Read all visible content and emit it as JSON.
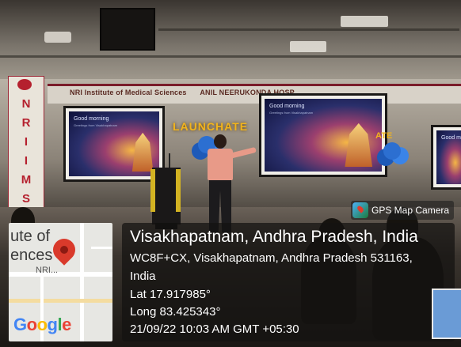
{
  "scene": {
    "banner_text": "NRI Institute of Medical Sciences",
    "banner_text_2": "ANIL NEERUKONDA HOSP",
    "vertical_banner_letters": [
      "N",
      "R",
      "I",
      "I",
      "M",
      "S"
    ],
    "sign_launch": "LAUNCHATE",
    "sign_right": "ATE",
    "slide_title": "Good morning",
    "slide_subtitle": "Greetings from Visakhapatnam"
  },
  "map": {
    "label_line1": "ute of",
    "label_line2": "ences",
    "label_line3": "NRI...",
    "logo_letters": [
      {
        "ch": "G",
        "color": "#4285F4"
      },
      {
        "ch": "o",
        "color": "#EA4335"
      },
      {
        "ch": "o",
        "color": "#FBBC05"
      },
      {
        "ch": "g",
        "color": "#4285F4"
      },
      {
        "ch": "l",
        "color": "#34A853"
      },
      {
        "ch": "e",
        "color": "#EA4335"
      }
    ]
  },
  "badge": {
    "label": "GPS Map Camera",
    "icon": "gps-map-camera-icon"
  },
  "info": {
    "title": "Visakhapatnam, Andhra Pradesh, India",
    "address_line1": "WC8F+CX, Visakhapatnam, Andhra Pradesh 531163,",
    "address_line2": "India",
    "lat": "Lat 17.917985°",
    "long": "Long 83.425343°",
    "datetime": "21/09/22 10:03 AM GMT +05:30"
  }
}
